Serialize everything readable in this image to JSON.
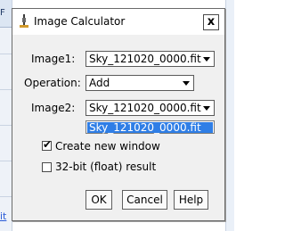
{
  "background": {
    "left_tab_text": "F",
    "bottom_left_text": "it"
  },
  "dialog": {
    "title": "Image Calculator",
    "icon": "imagej-microscope-icon",
    "close_label": "x",
    "fields": {
      "image1": {
        "label": "Image1:",
        "value": "Sky_121020_0000.fit"
      },
      "operation": {
        "label": "Operation:",
        "value": "Add"
      },
      "image2": {
        "label": "Image2:",
        "value": "Sky_121020_0000.fit"
      }
    },
    "image2_dropdown": {
      "options": [
        "Sky_121020_0000.fit"
      ],
      "highlighted": "Sky_121020_0000.fit"
    },
    "options": {
      "create_new_window": {
        "label": "Create new window",
        "checked": true
      },
      "float_result": {
        "label": "32-bit (float) result",
        "checked": false
      }
    },
    "buttons": {
      "ok": "OK",
      "cancel": "Cancel",
      "help": "Help"
    }
  },
  "colors": {
    "highlight": "#2f7ee6",
    "dialog_bg": "#f0f0f0"
  }
}
